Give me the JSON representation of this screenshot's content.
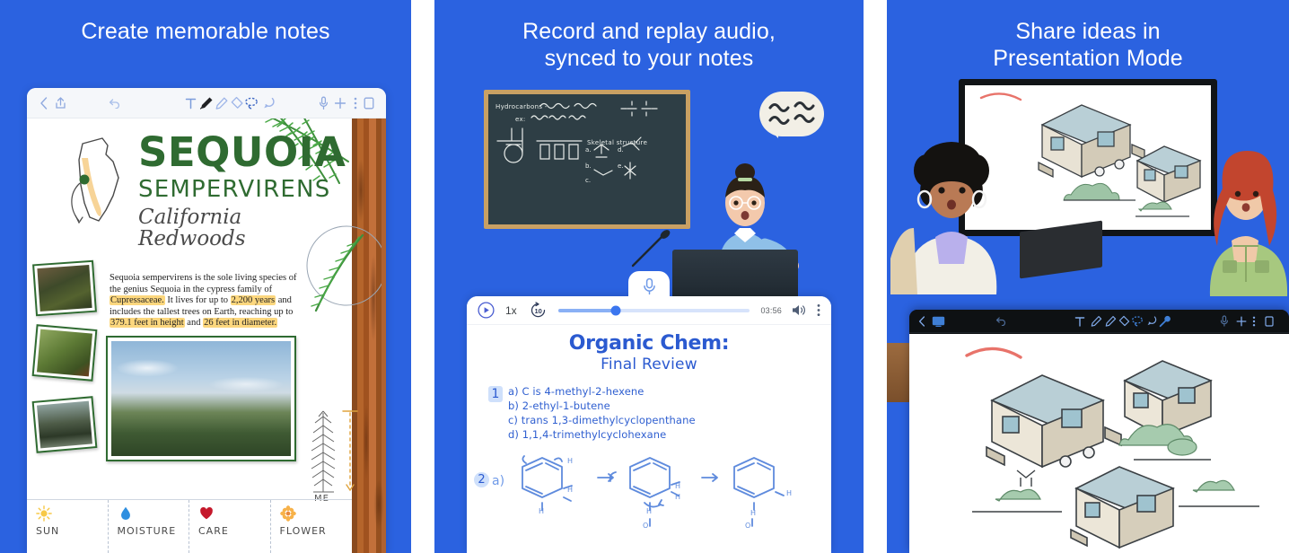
{
  "brand": {
    "bg_blue": "#2B62E0",
    "accent_green": "#2F6B31",
    "ink_blue": "#2B5AD0",
    "highlight": "#FCD77E"
  },
  "panels": [
    {
      "id": "create-notes",
      "headline": "Create memorable notes",
      "toolbar": {
        "icons": [
          "back-icon",
          "share-icon",
          "undo-icon",
          "text-tool-icon",
          "pen-tool-icon",
          "highlighter-tool-icon",
          "eraser-tool-icon",
          "lasso-tool-icon",
          "shape-tool-icon",
          "microphone-icon",
          "add-icon",
          "overflow-menu-icon",
          "page-icon"
        ]
      },
      "note": {
        "title": "SEQUOIA",
        "subtitle": "SEMPERVIRENS",
        "subtitle2": "California Redwoods",
        "body_parts": [
          {
            "text": "Sequoia sempervirens is the sole living species of the genius Sequoia in the cypress family of ",
            "highlight": false
          },
          {
            "text": "Cupressaceae.",
            "highlight": true
          },
          {
            "text": " It lives for up to ",
            "highlight": false
          },
          {
            "text": "2,200 years",
            "highlight": true
          },
          {
            "text": " and includes the tallest trees on Earth, reaching up to ",
            "highlight": false
          },
          {
            "text": "379.1 feet in height",
            "highlight": true
          },
          {
            "text": " and ",
            "highlight": false
          },
          {
            "text": "26 feet in diameter.",
            "highlight": true
          }
        ],
        "tree_label": "ME",
        "cards": [
          {
            "icon": "sun-icon",
            "label": "SUN"
          },
          {
            "icon": "water-drop-icon",
            "label": "MOISTURE"
          },
          {
            "icon": "heart-icon",
            "label": "CARE"
          },
          {
            "icon": "flower-icon",
            "label": "FLOWER"
          }
        ]
      }
    },
    {
      "id": "record-audio",
      "headline_line1": "Record and replay audio,",
      "headline_line2": "synced to your notes",
      "chalkboard": {
        "line1": "Hydrocarbons -",
        "line2": "ex:",
        "line3": "Skeletal structure",
        "items": [
          "a.",
          "b.",
          "c.",
          "d.",
          "e."
        ]
      },
      "player": {
        "play_icon": "play-circle-icon",
        "speed": "1x",
        "skip_label": "10",
        "skip_icon": "replay-10-icon",
        "time": "03:56",
        "volume_icon": "volume-icon",
        "menu_icon": "overflow-menu-icon",
        "mic_icon": "microphone-icon",
        "progress_percent": 30
      },
      "notes": {
        "title": "Organic Chem:",
        "subtitle": "Final Review",
        "q1_number": "1",
        "q1_items": [
          "a) C is 4-methyl-2-hexene",
          "b) 2-ethyl-1-butene",
          "c) trans 1,3-dimethylcyclopenthane",
          "d) 1,1,4-trimethylcyclohexane"
        ],
        "q2_number": "2",
        "q2_label": "a)"
      }
    },
    {
      "id": "presentation-mode",
      "headline_line1": "Share ideas in",
      "headline_line2": "Presentation Mode",
      "toolbar": {
        "icons": [
          "back-icon",
          "cast-screen-icon",
          "undo-icon",
          "text-tool-icon",
          "pen-tool-icon",
          "highlighter-tool-icon",
          "eraser-tool-icon",
          "lasso-tool-icon",
          "shape-tool-icon",
          "laser-pointer-icon",
          "microphone-icon",
          "add-icon",
          "overflow-menu-icon",
          "page-icon"
        ]
      },
      "content": {
        "subject": "tiny-house-sketches"
      }
    }
  ]
}
